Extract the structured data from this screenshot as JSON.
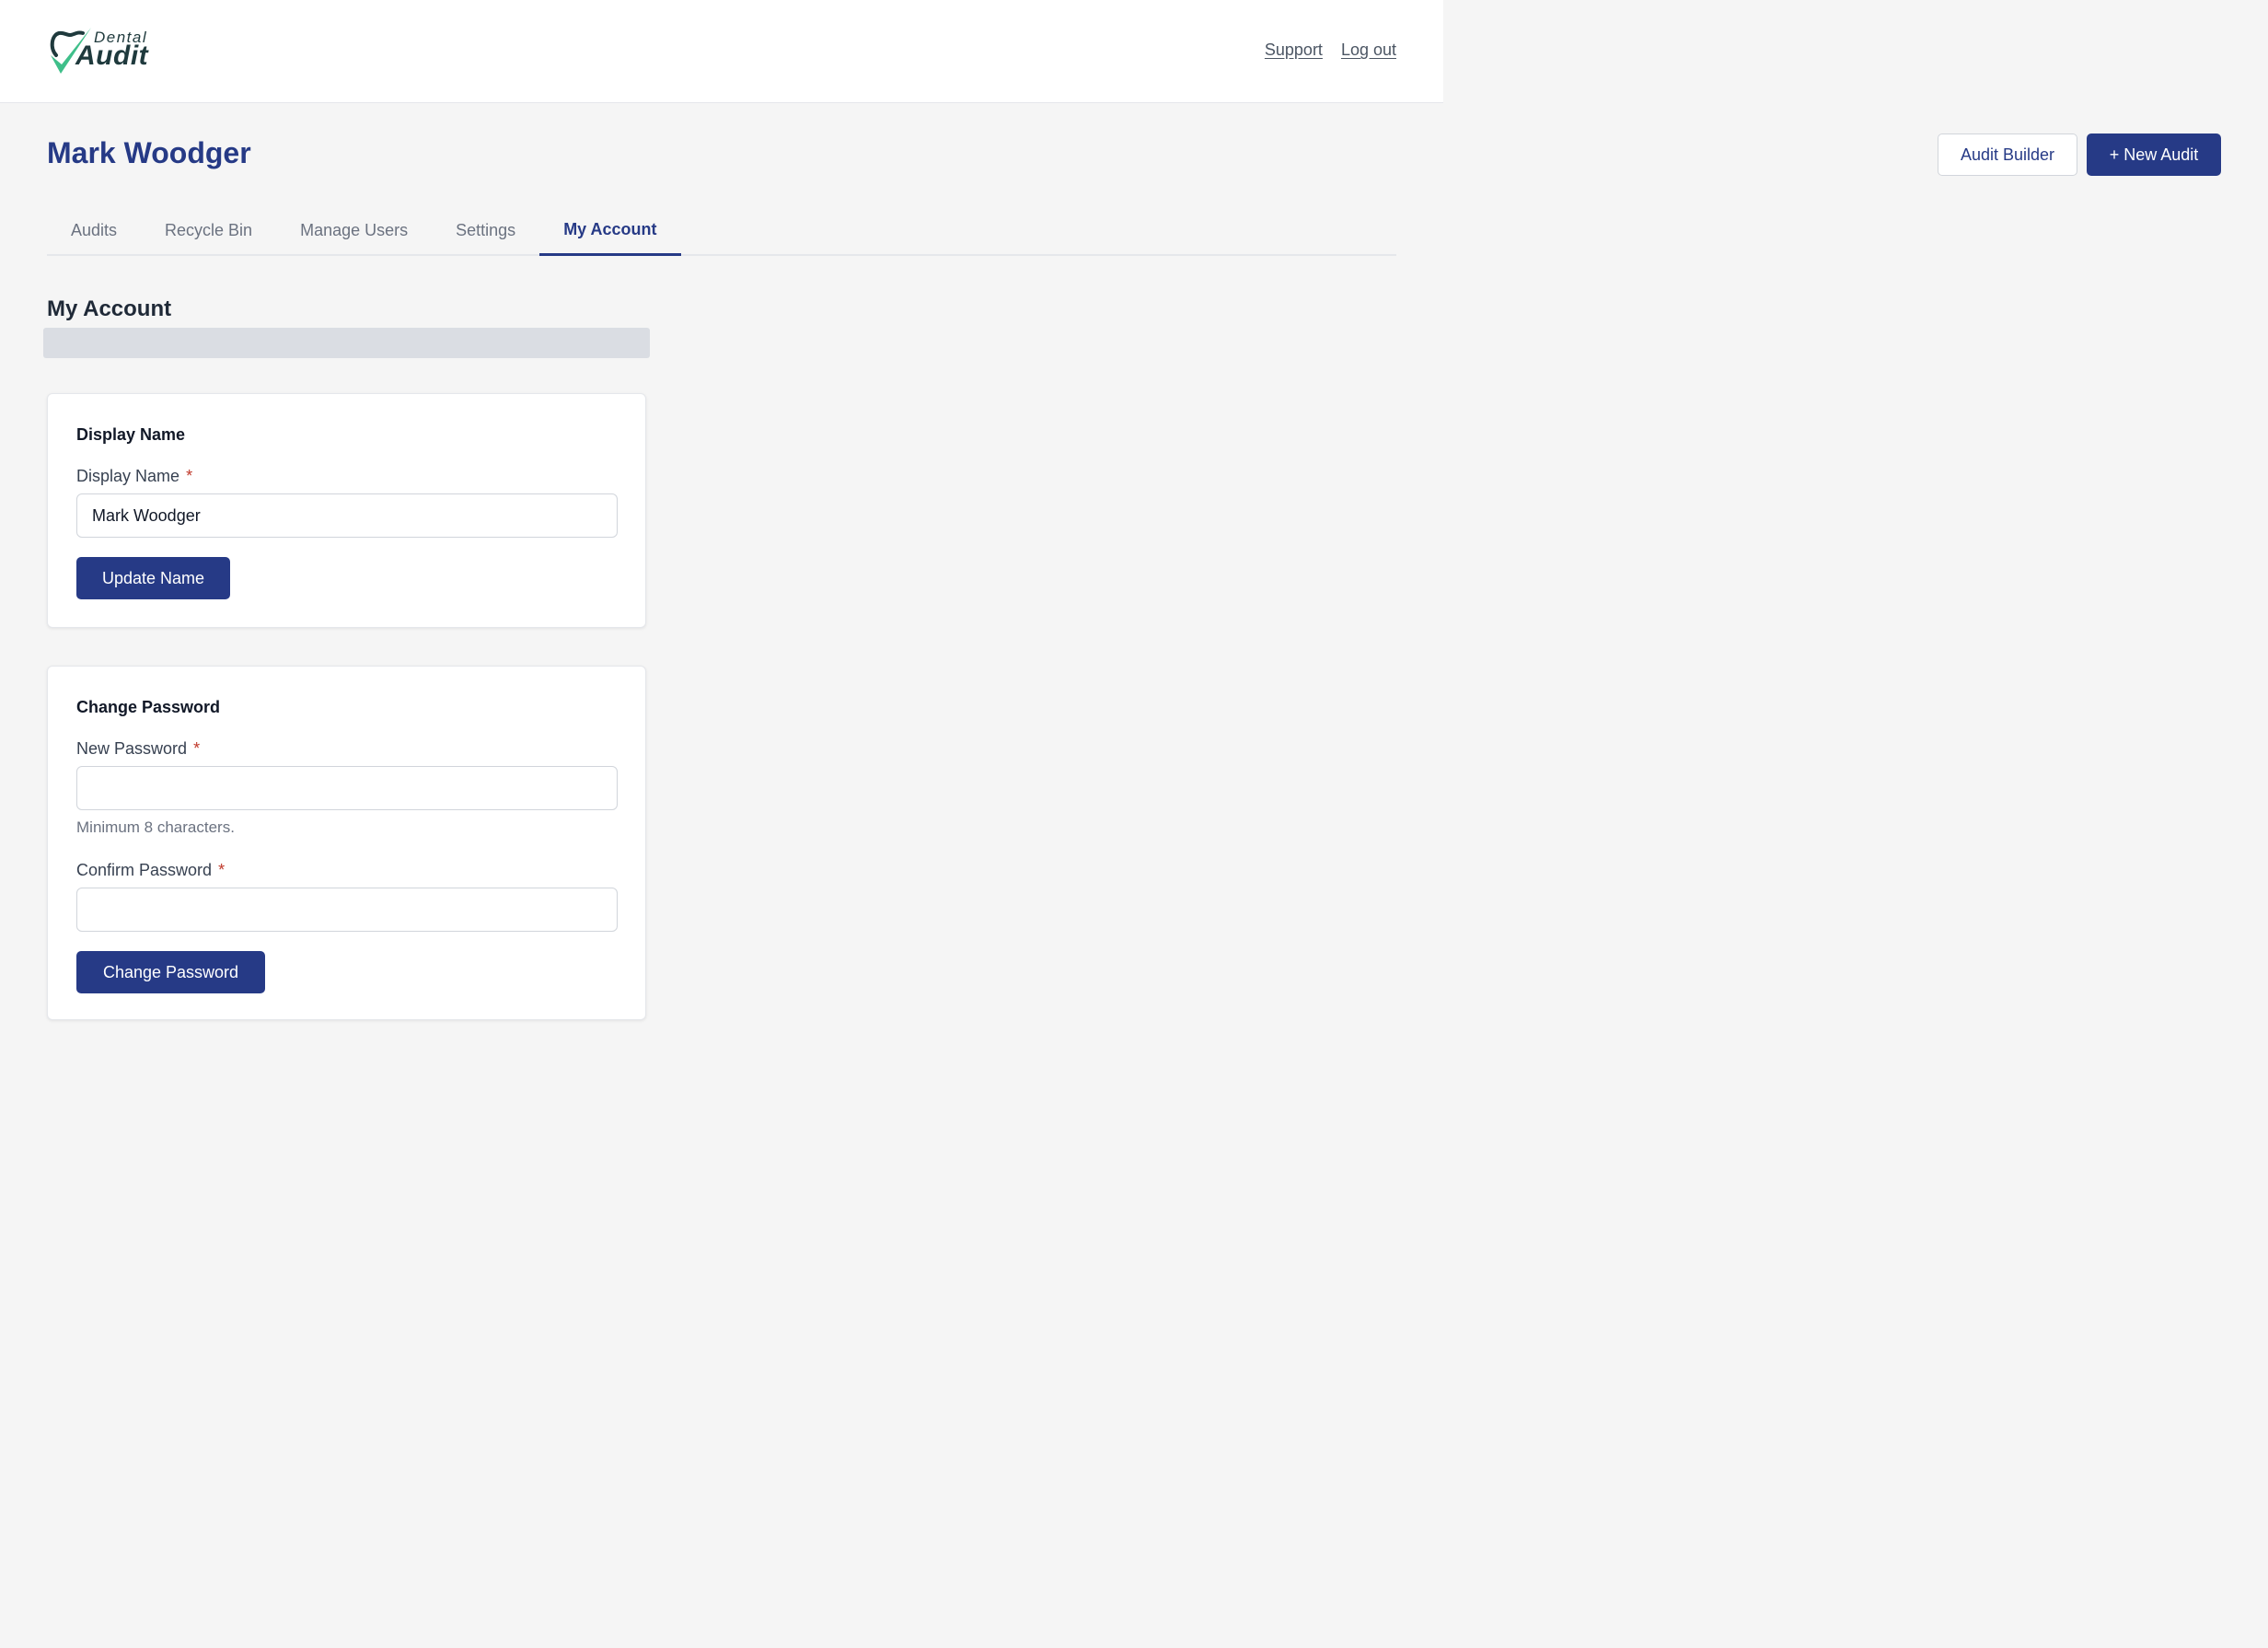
{
  "brand": {
    "logo_top": "Dental",
    "logo_bottom": "Audit",
    "accent_color": "#263a86",
    "check_color": "#3fbf8a"
  },
  "header": {
    "support_label": "Support",
    "logout_label": "Log out"
  },
  "page": {
    "title": "Mark Woodger",
    "audit_builder_label": "Audit Builder",
    "new_audit_label": "+ New Audit"
  },
  "tabs": [
    {
      "label": "Audits",
      "active": false
    },
    {
      "label": "Recycle Bin",
      "active": false
    },
    {
      "label": "Manage Users",
      "active": false
    },
    {
      "label": "Settings",
      "active": false
    },
    {
      "label": "My Account",
      "active": true
    }
  ],
  "section": {
    "title": "My Account"
  },
  "display_name_card": {
    "heading": "Display Name",
    "field_label": "Display Name",
    "required_mark": "*",
    "value": "Mark Woodger",
    "button_label": "Update Name"
  },
  "password_card": {
    "heading": "Change Password",
    "new_label": "New Password",
    "new_value": "",
    "required_mark": "*",
    "help_text": "Minimum 8 characters.",
    "confirm_label": "Confirm Password",
    "confirm_value": "",
    "button_label": "Change Password"
  }
}
